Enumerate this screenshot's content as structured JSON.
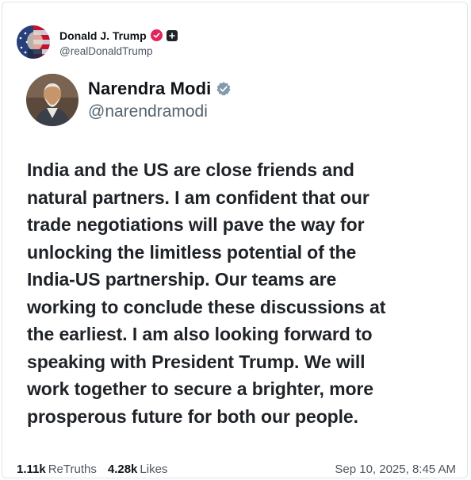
{
  "post": {
    "author": {
      "name": "Donald J. Trump",
      "handle": "@realDonaldTrump",
      "verified_icon": "verified-badge-icon",
      "extra_icon": "plus-badge-icon"
    },
    "embedded": {
      "author": {
        "name": "Narendra Modi",
        "handle": "@narendramodi",
        "verified_icon": "verified-badge-icon"
      },
      "text_lines": [
        "India and the US are close friends and",
        "natural partners. I am confident that our",
        "trade negotiations will pave the way for",
        "unlocking the limitless potential of the",
        "India-US partnership. Our teams are",
        "working to conclude these discussions at",
        "the earliest. I am also looking forward to",
        "speaking with President Trump. We will",
        "work together to secure a brighter, more",
        "prosperous future for both our people."
      ]
    },
    "stats": {
      "retruths_count": "1.11k",
      "retruths_label": "ReTruths",
      "likes_count": "4.28k",
      "likes_label": "Likes"
    },
    "timestamp": "Sep 10, 2025, 8:45 AM"
  },
  "colors": {
    "ts_verified": "#e0245e",
    "x_verified": "#829aab",
    "text_primary": "#0f1419",
    "text_secondary": "#536471"
  }
}
